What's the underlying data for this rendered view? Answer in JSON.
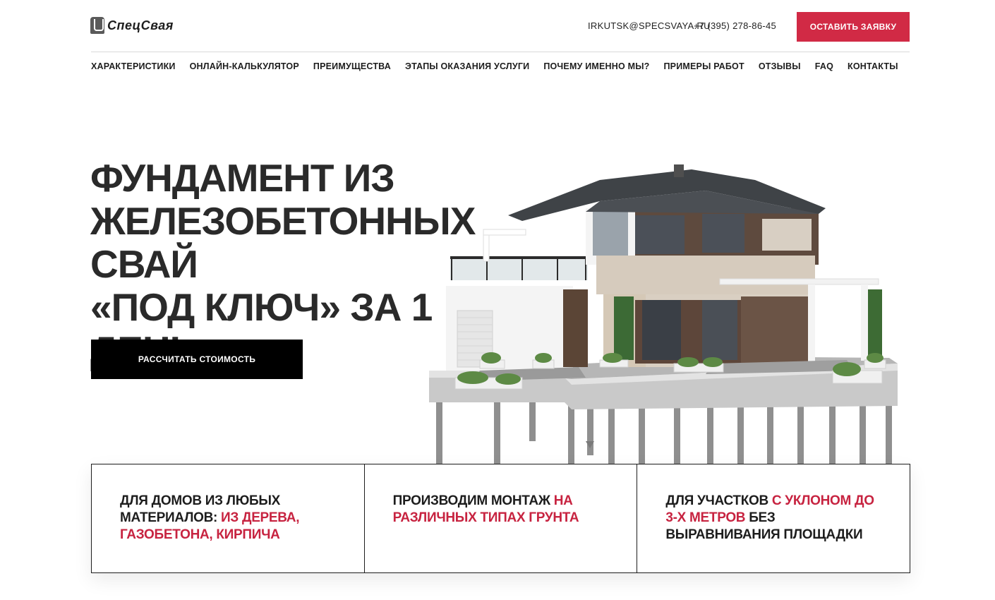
{
  "header": {
    "logo_text": "СпецСвая",
    "email": "IRKUTSK@SPECSVAYA.RU",
    "phone": "+7 (395) 278-86-45",
    "cta_label": "ОСТАВИТЬ ЗАЯВКУ"
  },
  "nav": {
    "items": [
      {
        "label": "ХАРАКТЕРИСТИКИ"
      },
      {
        "label": "ОНЛАЙН-КАЛЬКУЛЯТОР"
      },
      {
        "label": "ПРЕИМУЩЕСТВА"
      },
      {
        "label": "ЭТАПЫ ОКАЗАНИЯ УСЛУГИ"
      },
      {
        "label": "ПОЧЕМУ ИМЕННО МЫ?"
      },
      {
        "label": "ПРИМЕРЫ РАБОТ"
      },
      {
        "label": "ОТЗЫВЫ"
      },
      {
        "label": "FAQ"
      },
      {
        "label": "КОНТАКТЫ"
      }
    ]
  },
  "hero": {
    "title_line1": "ФУНДАМЕНТ ИЗ",
    "title_line2": "ЖЕЛЕЗОБЕТОННЫХ СВАЙ",
    "title_line3": "«ПОД КЛЮЧ» ЗА 1 ДЕНЬ",
    "cta_label": "РАССЧИТАТЬ СТОИМОСТЬ"
  },
  "features": [
    {
      "text_dark": "ДЛЯ ДОМОВ ИЗ ЛЮБЫХ МАТЕРИАЛОВ:",
      "text_red": "ИЗ ДЕРЕВА, ГАЗОБЕТОНА, КИРПИЧА",
      "text_dark2": ""
    },
    {
      "text_dark": "ПРОИЗВОДИМ МОНТАЖ",
      "text_red": "НА РАЗЛИЧНЫХ ТИПАХ ГРУНТА",
      "text_dark2": ""
    },
    {
      "text_dark": "ДЛЯ УЧАСТКОВ",
      "text_red": "С УКЛОНОМ ДО 3-Х МЕТРОВ",
      "text_dark2": "БЕЗ ВЫРАВНИВАНИЯ ПЛОЩАДКИ"
    }
  ],
  "colors": {
    "accent": "#d12a45",
    "text_red": "#c72340",
    "text_dark": "#1d1d1d",
    "button_dark": "#000000"
  }
}
